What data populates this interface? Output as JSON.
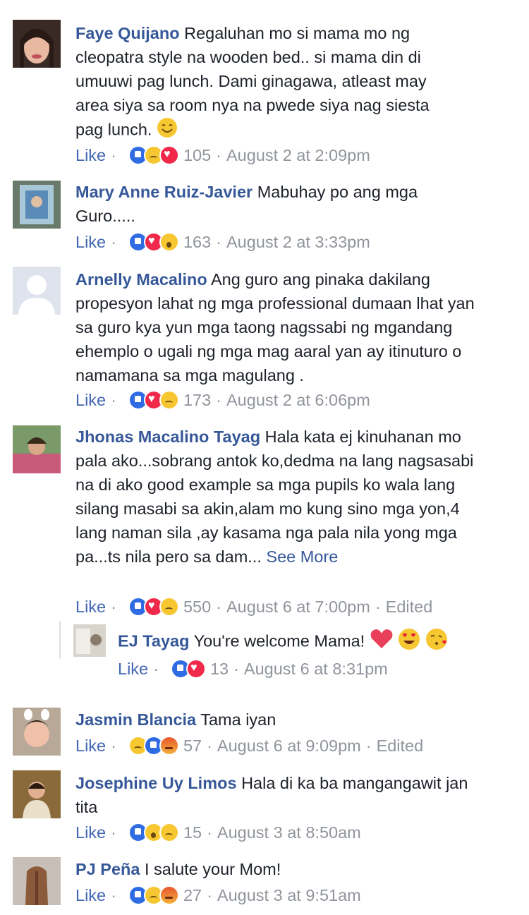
{
  "like_label": "Like",
  "comments": [
    {
      "author": "Faye Quijano",
      "text": "Regaluhan mo si mama mo ng cleopatra style na wooden bed.. si mama din di umuuwi pag lunch. Dami ginagawa, atleast may area siya sa room nya na pwede siya nag siesta pag lunch.",
      "reaction_icons": [
        "like-icon",
        "sad-icon",
        "love-icon"
      ],
      "reaction_count": "105",
      "timestamp": "August 2 at 2:09pm"
    },
    {
      "author": "Mary Anne Ruiz-Javier",
      "text": "Mabuhay po ang mga Guro.....",
      "reaction_icons": [
        "like-icon",
        "love-icon",
        "wow-icon"
      ],
      "reaction_count": "163",
      "timestamp": "August 2 at 3:33pm"
    },
    {
      "author": "Arnelly Macalino",
      "text": "Ang guro ang pinaka dakilang propesyon lahat ng mga professional dumaan lhat yan sa guro kya yun mga taong nagssabi ng mgandang ehemplo o ugali ng mga mag aaral yan ay itinuturo o namamana sa mga magulang .",
      "reaction_icons": [
        "like-icon",
        "love-icon",
        "sad-icon"
      ],
      "reaction_count": "173",
      "timestamp": "August 2 at 6:06pm"
    },
    {
      "author": "Jhonas Macalino Tayag",
      "text": "Hala kata ej kinuhanan mo pala ako...sobrang antok ko,dedma na lang nagsasabi na di ako good example sa mga pupils ko wala lang silang masabi sa akin,alam mo kung sino mga yon,4 lang naman sila ,ay kasama nga pala nila yong mga pa...ts nila pero sa dam...",
      "see_more": "See More",
      "reaction_icons": [
        "like-icon",
        "love-icon",
        "sad-icon"
      ],
      "reaction_count": "550",
      "timestamp": "August 6 at 7:00pm",
      "edited": "Edited"
    },
    {
      "author": "EJ Tayag",
      "text": "You're welcome Mama!",
      "reaction_icons": [
        "like-icon",
        "love-icon"
      ],
      "reaction_count": "13",
      "timestamp": "August 6 at 8:31pm"
    },
    {
      "author": "Jasmin Blancia",
      "text": "Tama iyan",
      "reaction_icons": [
        "sad-icon",
        "like-icon",
        "angry-icon"
      ],
      "reaction_count": "57",
      "timestamp": "August 6 at 9:09pm",
      "edited": "Edited"
    },
    {
      "author": "Josephine Uy Limos",
      "text": "Hala di ka ba mangangawit jan tita",
      "reaction_icons": [
        "like-icon",
        "wow-icon",
        "sad-icon"
      ],
      "reaction_count": "15",
      "timestamp": "August 3 at 8:50am"
    },
    {
      "author": "PJ Peña",
      "text": "I salute your Mom!",
      "reaction_icons": [
        "like-icon",
        "sad-icon",
        "angry-icon"
      ],
      "reaction_count": "27",
      "timestamp": "August 3 at 9:51am"
    }
  ]
}
